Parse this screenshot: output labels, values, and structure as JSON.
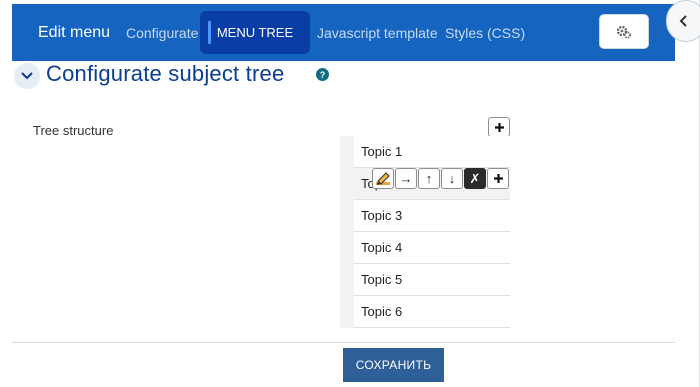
{
  "header": {
    "title": "Edit menu",
    "tabs": [
      {
        "label": "Configurate"
      },
      {
        "label": "MENU TREE"
      },
      {
        "label": "Javascript template"
      },
      {
        "label": "Styles (CSS)"
      }
    ],
    "settings_icon": "gears-icon"
  },
  "drawer": {
    "icon": "chevron-left-icon"
  },
  "section": {
    "title": "Configurate subject tree",
    "help_icon": "?",
    "collapse_icon": "chevron-down-icon"
  },
  "tree": {
    "label": "Tree structure",
    "add_symbol": "+",
    "topics": [
      {
        "label": "Topic 1"
      },
      {
        "label": "Topic 2"
      },
      {
        "label": "Topic 3"
      },
      {
        "label": "Topic 4"
      },
      {
        "label": "Topic 5"
      },
      {
        "label": "Topic 6"
      }
    ],
    "row_actions": [
      {
        "name": "edit",
        "icon": "pencil-icon",
        "glyph": ""
      },
      {
        "name": "indent",
        "icon": "arrow-right-icon",
        "glyph": "→"
      },
      {
        "name": "move-up",
        "icon": "arrow-up-icon",
        "glyph": "↑"
      },
      {
        "name": "move-down",
        "icon": "arrow-down-icon",
        "glyph": "↓"
      },
      {
        "name": "delete",
        "icon": "delete-x-icon",
        "glyph": "✗"
      },
      {
        "name": "add-child",
        "icon": "plus-icon",
        "glyph": "+"
      }
    ]
  },
  "footer": {
    "save_label": "СОХРАНИТЬ"
  },
  "colors": {
    "header_bg": "#1565c0",
    "active_tab_bg": "#0a3ea5",
    "title_color": "#0b3d91",
    "save_button_bg": "#2f5f98"
  }
}
